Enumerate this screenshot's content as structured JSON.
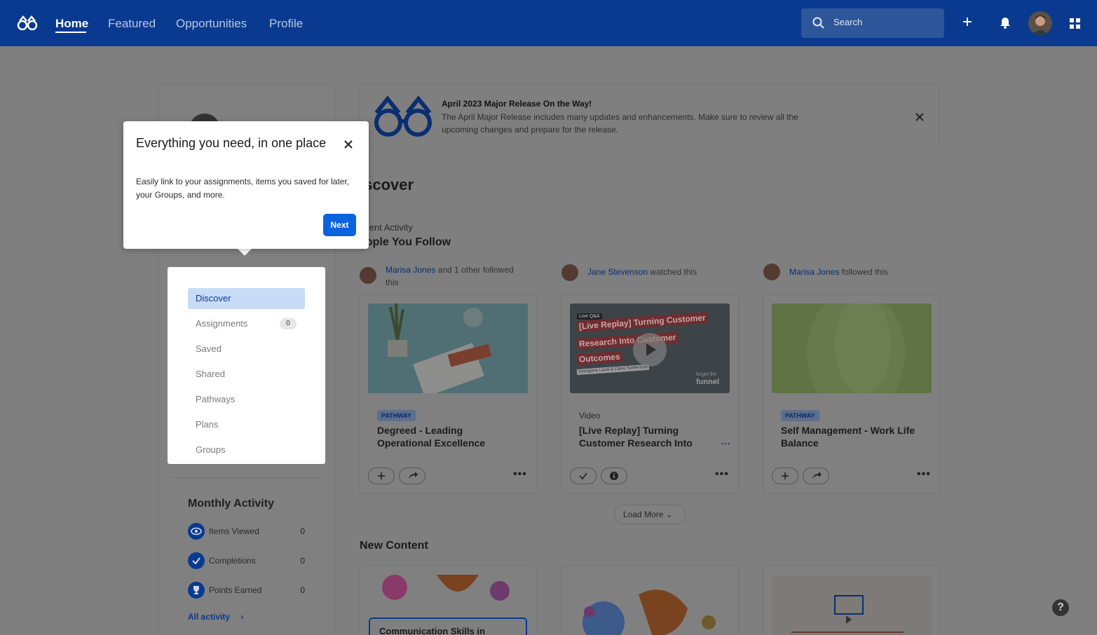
{
  "nav": {
    "links": [
      "Home",
      "Featured",
      "Opportunities",
      "Profile"
    ],
    "search_placeholder": "Search"
  },
  "sidebar": {
    "menu": [
      {
        "label": "Discover"
      },
      {
        "label": "Assignments",
        "badge": "0"
      },
      {
        "label": "Saved"
      },
      {
        "label": "Shared"
      },
      {
        "label": "Pathways"
      },
      {
        "label": "Plans"
      },
      {
        "label": "Groups"
      }
    ],
    "monthly_title": "Monthly Activity",
    "stats": [
      {
        "label": "Items Viewed",
        "value": "0",
        "icon": "eye-icon"
      },
      {
        "label": "Completions",
        "value": "0",
        "icon": "check-icon"
      },
      {
        "label": "Points Earned",
        "value": "0",
        "icon": "trophy-icon"
      }
    ],
    "all_activity": "All activity"
  },
  "banner": {
    "title": "April 2023 Major Release On the Way!",
    "text": "The April Major Release includes many updates and enhancements. Make sure to review all the upcoming changes and prepare for the release."
  },
  "main": {
    "discover": "iscover",
    "recent": "ecent Activity",
    "people": "eople You Follow",
    "load_more": "Load More",
    "new_content": "New Content"
  },
  "activity": [
    {
      "name": "Marisa Jones",
      "rest": " and 1 other followed this"
    },
    {
      "name": "Jane Stevenson",
      "rest": " watched this"
    },
    {
      "name": "Marisa Jones",
      "rest": " followed this"
    }
  ],
  "cards": [
    {
      "type": "PATHWAY",
      "title": "Degreed - Leading Operational Excellence"
    },
    {
      "type": "Video",
      "title": "[Live Replay] Turning Customer Research Into",
      "more": "..."
    },
    {
      "type": "PATHWAY",
      "title": "Self Management - Work Life Balance"
    }
  ],
  "video_thumb": {
    "tag": "Live Q&A",
    "line1": "[Live Replay] Turning Customer",
    "line2": "Research Into Customer",
    "line3": "Outcomes",
    "speakers": "Georgiana Laudi & Claire Suellentrop",
    "brand_small": "forget the",
    "brand": "funnel"
  },
  "new_content_thumb": "Communication Skills in",
  "tooltip": {
    "title": "Everything you need, in one place",
    "text": "Easily link to your assignments, items you saved for later, your Groups, and more.",
    "next": "Next"
  },
  "help": "?",
  "colors": {
    "brand": "#0a3a8f",
    "accent": "#0b63e0",
    "overlay": "#7f7f7f"
  }
}
